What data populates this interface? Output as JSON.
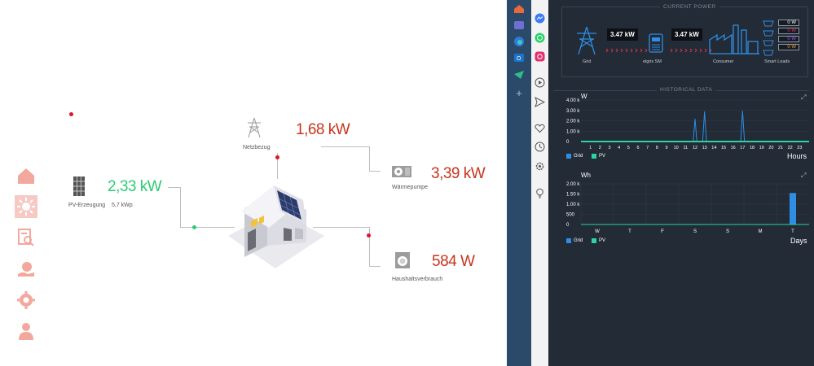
{
  "flow": {
    "grid": {
      "label": "Netzbezug",
      "value": "1,68 kW"
    },
    "pv": {
      "label": "PV-Erzeugung",
      "value": "2,33 kW",
      "capacity": "5,7 kWp"
    },
    "heatpump": {
      "label": "Wärmepumpe",
      "value": "3,39 kW"
    },
    "household": {
      "label": "Haushaltsverbrauch",
      "value": "584 W"
    },
    "colors": {
      "import": "#c8341c",
      "export": "#2ecb73",
      "nav": "#f3a89d"
    }
  },
  "nav": {
    "items": [
      "home-icon",
      "sun-icon",
      "search-report-icon",
      "savings-icon",
      "gear-icon",
      "user-icon"
    ]
  },
  "current_power": {
    "title": "CURRENT POWER",
    "grid_value": "3.47 kW",
    "meter_value": "3.47 kW",
    "labels": {
      "grid": "Grid",
      "meter": "elgris SM",
      "consumer": "Consumer",
      "smart": "Smart Loads"
    },
    "smart_loads": [
      {
        "value": "0 W",
        "color": "#ffffff"
      },
      {
        "value": "0 W",
        "color": "#e0344c"
      },
      {
        "value": "0 W",
        "color": "#9b59ff"
      },
      {
        "value": "0 W",
        "color": "#f0a030"
      }
    ]
  },
  "historical": {
    "title": "HISTORICAL DATA",
    "chart_hours": {
      "unit": "W",
      "xlabel": "Hours",
      "y_ticks": [
        "4.00 k",
        "3.00 k",
        "2.00 k",
        "1.00 k",
        "0"
      ],
      "x_ticks": [
        "1",
        "2",
        "3",
        "4",
        "5",
        "6",
        "7",
        "8",
        "9",
        "10",
        "11",
        "12",
        "13",
        "14",
        "15",
        "16",
        "17",
        "18",
        "19",
        "20",
        "21",
        "22",
        "23"
      ],
      "legend": [
        {
          "name": "Grid",
          "color": "#2f8de4"
        },
        {
          "name": "PV",
          "color": "#2ed3a0"
        }
      ]
    },
    "chart_days": {
      "unit": "Wh",
      "xlabel": "Days",
      "y_ticks": [
        "2.00 k",
        "1.50 k",
        "1.00 k",
        "500",
        "0"
      ],
      "x_ticks": [
        "W",
        "T",
        "F",
        "S",
        "S",
        "M",
        "T"
      ],
      "legend": [
        {
          "name": "Grid",
          "color": "#2f8de4"
        },
        {
          "name": "PV",
          "color": "#2ed3a0"
        }
      ]
    }
  },
  "chart_data": [
    {
      "type": "line",
      "ylabel": "W",
      "xlabel": "Hours",
      "ylim": [
        0,
        4000
      ],
      "x": [
        0,
        1,
        2,
        3,
        4,
        5,
        6,
        7,
        8,
        9,
        10,
        11,
        12,
        13,
        14,
        15,
        16,
        17,
        18,
        19,
        20,
        21,
        22,
        23,
        24
      ],
      "series": [
        {
          "name": "Grid",
          "values": [
            0,
            0,
            0,
            0,
            0,
            0,
            0,
            0,
            0,
            0,
            0,
            0,
            2200,
            2900,
            0,
            0,
            0,
            2950,
            0,
            0,
            0,
            0,
            0,
            0,
            0
          ]
        },
        {
          "name": "PV",
          "values": [
            0,
            0,
            0,
            0,
            0,
            0,
            0,
            0,
            0,
            0,
            0,
            0,
            0,
            0,
            0,
            0,
            0,
            0,
            0,
            0,
            0,
            0,
            0,
            0,
            0
          ]
        }
      ]
    },
    {
      "type": "bar",
      "ylabel": "Wh",
      "xlabel": "Days",
      "ylim": [
        0,
        2000
      ],
      "categories": [
        "W",
        "T",
        "F",
        "S",
        "S",
        "M",
        "T"
      ],
      "series": [
        {
          "name": "Grid",
          "values": [
            0,
            0,
            0,
            0,
            0,
            0,
            1550
          ]
        },
        {
          "name": "PV",
          "values": [
            0,
            0,
            0,
            0,
            0,
            0,
            0
          ]
        }
      ]
    }
  ]
}
